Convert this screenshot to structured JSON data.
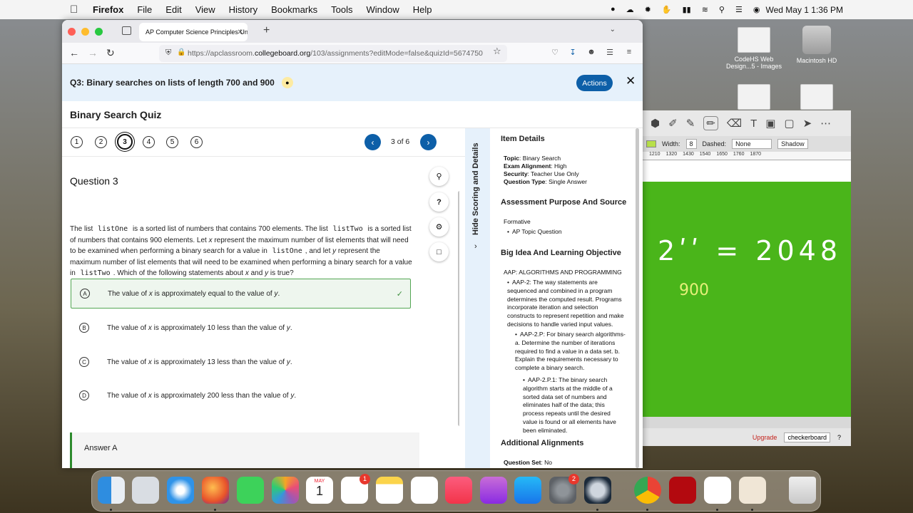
{
  "menubar": {
    "app": "Firefox",
    "items": [
      "File",
      "Edit",
      "View",
      "History",
      "Bookmarks",
      "Tools",
      "Window",
      "Help"
    ],
    "clock": "Wed May 1  1:36 PM"
  },
  "desktop_icons": [
    {
      "label": "CodeHS Web Design...5 - Images"
    },
    {
      "label": "Macintosh HD"
    }
  ],
  "drawing_app": {
    "width_label": "Width:",
    "width_value": "8",
    "dashed_label": "Dashed:",
    "dashed_value": "None",
    "shadow_label": "Shadow",
    "ruler": [
      "1210",
      "1320",
      "1430",
      "1540",
      "1650",
      "1760",
      "1870"
    ],
    "equation_text": "2ʹʹ = 2048",
    "number_text": "900",
    "upgrade": "Upgrade",
    "background_select": "checkerboard",
    "help": "?"
  },
  "browser": {
    "tab_title": "AP Computer Science Principles Un",
    "url_prefix": "https://apclassroom.",
    "url_domain": "collegeboard.org",
    "url_suffix": "/103/assignments?editMode=false&quizId=5674750"
  },
  "header": {
    "question_title": "Q3: Binary searches on lists of length 700 and 900",
    "actions_label": "Actions"
  },
  "quiz": {
    "title": "Binary Search Quiz",
    "question_numbers": [
      "1",
      "2",
      "3",
      "4",
      "5",
      "6"
    ],
    "page_indicator": "3 of 6",
    "question_heading": "Question 3",
    "question_text_parts": {
      "p1": "The list ",
      "c1": "listOne",
      "p2": " is a sorted list of numbers that contains 700 elements. The list ",
      "c2": "listTwo",
      "p3": " is a sorted list of numbers that contains 900 elements. Let ",
      "v1": "x",
      "p4": " represent the maximum number of list elements that will need to be examined when performing a binary search for a value in ",
      "c3": "listOne",
      "p5": ", and let ",
      "v2": "y",
      "p6": " represent the maximum number of list elements that will need to be examined when performing a binary search for a value in ",
      "c4": "listTwo",
      "p7": ". Which of the following statements about ",
      "v3": "x",
      "p8": " and ",
      "v4": "y",
      "p9": " is true?"
    },
    "choices": [
      {
        "letter": "A",
        "a": "The value of ",
        "x": "x",
        "b": " is approximately equal to the value of ",
        "y": "y",
        "c": "."
      },
      {
        "letter": "B",
        "a": "The value of ",
        "x": "x",
        "b": " is approximately 10 less than the value of ",
        "y": "y",
        "c": "."
      },
      {
        "letter": "C",
        "a": "The value of ",
        "x": "x",
        "b": " is approximately 13 less than the value of ",
        "y": "y",
        "c": "."
      },
      {
        "letter": "D",
        "a": "The value of ",
        "x": "x",
        "b": " is approximately 200 less than the value of ",
        "y": "y",
        "c": "."
      }
    ],
    "answer_label": "Answer A"
  },
  "details_tab_label": "Hide Scoring and Details",
  "item_details": {
    "heading": "Item Details",
    "topic_label": "Topic",
    "topic_value": ": Binary Search",
    "exam_label": "Exam Alignment",
    "exam_value": ": High",
    "security_label": "Security",
    "security_value": ": Teacher Use Only",
    "qtype_label": "Question Type",
    "qtype_value": ": Single Answer"
  },
  "assessment": {
    "heading": "Assessment Purpose And Source",
    "purpose": "Formative",
    "bullet": "AP Topic Question"
  },
  "big_idea": {
    "heading": "Big Idea And Learning Objective",
    "title": "AAP: ALGORITHMS AND PROGRAMMING",
    "b1": "AAP-2: The way statements are sequenced and combined in a program determines the computed result. Programs incorporate iteration and selection constructs to represent repetition and make decisions to handle varied input values.",
    "b2": "AAP-2.P: For binary search algorithms- a. Determine the number of iterations required to find a value in a data set. b. Explain the requirements necessary to complete a binary search.",
    "b3": "AAP-2.P.1: The binary search algorithm starts at the middle of a sorted data set of numbers and eliminates half of the data; this process repeats until the desired value is found or all elements have been eliminated."
  },
  "additional": {
    "heading": "Additional Alignments",
    "qset_label": "Question Set",
    "qset_value": ": No"
  },
  "dock": {
    "calendar_month": "MAY",
    "calendar_day": "1",
    "reminders_badge": "1",
    "settings_badge": "2"
  }
}
